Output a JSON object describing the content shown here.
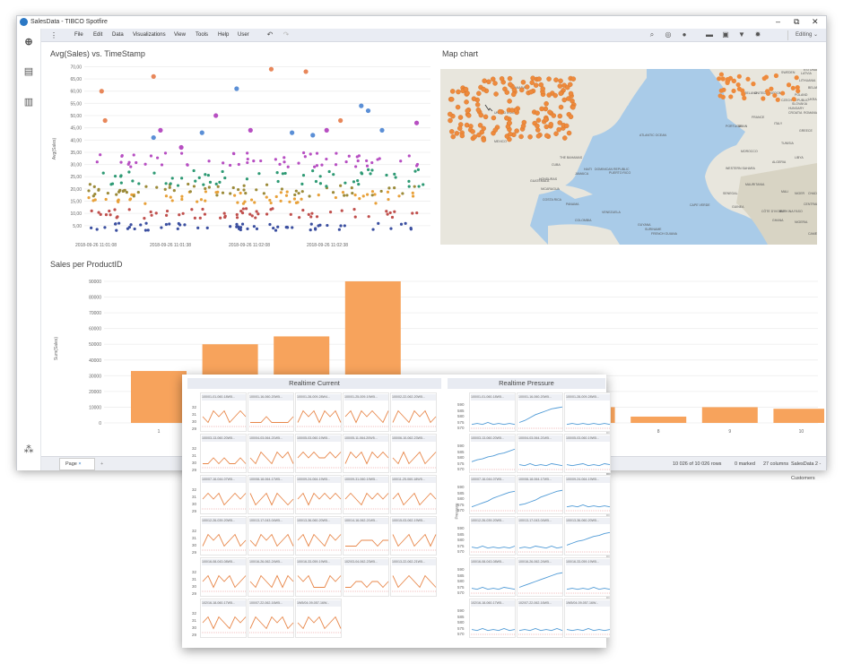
{
  "window": {
    "title": "SalesData - TIBCO Spotfire",
    "controls": {
      "minimize": "–",
      "restore": "⧉",
      "close": "✕"
    }
  },
  "menu": {
    "items": [
      "Menu",
      "File",
      "Edit",
      "Data",
      "Visualizations",
      "View",
      "Tools",
      "Help",
      "User"
    ],
    "mode": "Editing"
  },
  "scatter": {
    "title": "Avg(Sales) vs. TimeStamp",
    "xlabel": "TimeStamp",
    "ylabel": "Avg(Sales)"
  },
  "map": {
    "title": "Map chart",
    "labels": [
      "CANADA",
      "UNITED STATES",
      "MEXICO",
      "ATLANTIC OCEAN",
      "CUBA",
      "THE BAHAMAS",
      "DOMINICAN REPUBLIC",
      "JAMAICA",
      "HAITI",
      "PUERTO RICO",
      "GUATEMALA",
      "HONDURAS",
      "NICARAGUA",
      "COSTA RICA",
      "PANAMA",
      "COLOMBIA",
      "VENEZUELA",
      "GUYANA",
      "SURINAME",
      "FRENCH GUIANA",
      "MOROCCO",
      "ALGERIA",
      "LIBYA",
      "EGYPT",
      "MALI",
      "NIGER",
      "CHAD",
      "SUDAN",
      "MAURITANIA",
      "SENEGAL",
      "GUINEA",
      "CÔTE D'IVOIRE",
      "BURKINA FASO",
      "GHANA",
      "NIGERIA",
      "CENTRAL AFRICAN REPUBLIC",
      "PORTUGAL",
      "SPAIN",
      "FRANCE",
      "ITALY",
      "GREECE",
      "CROATIA",
      "POLAND",
      "CZECH REPUBLIC",
      "SLOVAKIA",
      "UKRAINE",
      "BELARUS",
      "LITHUANIA",
      "LATVIA",
      "ESTONIA",
      "SWEDEN",
      "UNITED KINGDOM",
      "IRELAND",
      "TUNISIA",
      "WESTERN SAHARA",
      "CAPE VERDE",
      "CAMEROON",
      "ROMANIA",
      "HUNGARY"
    ]
  },
  "bar": {
    "title": "Sales per ProductID",
    "ylabel": "Sum(Sales)"
  },
  "chart_data": [
    {
      "type": "scatter",
      "title": "Avg(Sales) vs. TimeStamp",
      "xlabel": "TimeStamp",
      "ylabel": "Avg(Sales)",
      "x_ticks": [
        "2018-09-26 11:01:08",
        "2018-09-26 11:01:38",
        "2018-09-26 11:02:08",
        "2018-09-26 11:02:38"
      ],
      "y_ticks": [
        "5,00",
        "10,00",
        "15,00",
        "20,00",
        "25,00",
        "30,00",
        "35,00",
        "40,00",
        "45,00",
        "50,00",
        "55,00",
        "60,00",
        "65,00",
        "70,00"
      ],
      "ylim": [
        2,
        72
      ],
      "series_bands": [
        {
          "name": "band1",
          "color": "#3b4fa0",
          "y_range": [
            3,
            6
          ]
        },
        {
          "name": "band2",
          "color": "#c0504d",
          "y_range": [
            8,
            12
          ]
        },
        {
          "name": "band3",
          "color": "#e8a13a",
          "y_range": [
            14,
            19
          ]
        },
        {
          "name": "band4",
          "color": "#9c8b3a",
          "y_range": [
            17,
            22
          ]
        },
        {
          "name": "band5",
          "color": "#2e9a74",
          "y_range": [
            21,
            28
          ]
        },
        {
          "name": "band6",
          "color": "#b74fc2",
          "y_range": [
            29,
            35
          ]
        }
      ],
      "outliers": [
        {
          "x": 0.05,
          "y": 60,
          "color": "#e8875a"
        },
        {
          "x": 0.06,
          "y": 48,
          "color": "#e8875a"
        },
        {
          "x": 0.2,
          "y": 66,
          "color": "#e8875a"
        },
        {
          "x": 0.44,
          "y": 61,
          "color": "#5b8fd6"
        },
        {
          "x": 0.54,
          "y": 69,
          "color": "#e8875a"
        },
        {
          "x": 0.64,
          "y": 68,
          "color": "#e8875a"
        },
        {
          "x": 0.8,
          "y": 54,
          "color": "#5b8fd6"
        },
        {
          "x": 0.82,
          "y": 52,
          "color": "#5b8fd6"
        },
        {
          "x": 0.74,
          "y": 48,
          "color": "#e8875a"
        },
        {
          "x": 0.96,
          "y": 47,
          "color": "#b74fc2"
        },
        {
          "x": 0.2,
          "y": 41,
          "color": "#5b8fd6"
        },
        {
          "x": 0.22,
          "y": 44,
          "color": "#b74fc2"
        },
        {
          "x": 0.34,
          "y": 43,
          "color": "#5b8fd6"
        },
        {
          "x": 0.48,
          "y": 44,
          "color": "#b74fc2"
        },
        {
          "x": 0.38,
          "y": 50,
          "color": "#b74fc2"
        },
        {
          "x": 0.6,
          "y": 43,
          "color": "#5b8fd6"
        },
        {
          "x": 0.66,
          "y": 42,
          "color": "#5b8fd6"
        },
        {
          "x": 0.7,
          "y": 44,
          "color": "#b74fc2"
        },
        {
          "x": 0.86,
          "y": 44,
          "color": "#5b8fd6"
        },
        {
          "x": 0.28,
          "y": 37,
          "color": "#b74fc2"
        }
      ]
    },
    {
      "type": "bar",
      "title": "Sales per ProductID",
      "ylabel": "Sum(Sales)",
      "categories": [
        "1",
        "2",
        "3",
        "4",
        "5",
        "6",
        "7",
        "8",
        "9",
        "10"
      ],
      "values": [
        33000,
        50000,
        55000,
        90000,
        12000,
        8000,
        10000,
        4000,
        10000,
        9000
      ],
      "ylim": [
        0,
        90000
      ],
      "y_ticks": [
        "0",
        "10000",
        "20000",
        "30000",
        "40000",
        "50000",
        "60000",
        "70000",
        "80000",
        "90000"
      ],
      "color": "#f7a35c"
    }
  ],
  "overlay": {
    "current": {
      "title": "Realtime Current",
      "y_ticks": [
        "32",
        "31",
        "30",
        "29"
      ],
      "cells": [
        "100/01-01-060-18W5...",
        "100/01-16-060-20W5...",
        "100/01-28-009-28W4...",
        "100/01-25-009-19W5...",
        "100/02-22-062-20W5...",
        "100/03-13-060-20W5...",
        "100/04-03-064-21W5...",
        "100/05-03-060-19W5...",
        "100/05-11-064-20W5...",
        "100/06-10-062-23W5...",
        "100/07-16-044-07W5...",
        "100/08-18-064-17W5...",
        "100/09-24-064-19W5...",
        "100/09-31-060-19W5...",
        "100/11-25-060-18W5...",
        "100/12-26-039-20W5...",
        "100/13-17-043-04W5...",
        "100/13-36-060-20W5...",
        "100/14-16-062-21W5...",
        "100/15-03-062-19W5...",
        "100/16-08-043-08W5...",
        "100/16-26-062-24W5...",
        "100/16-33-059-19W5...",
        "102/03-04-062-23W5...",
        "100/13-22-062-21W5...",
        "102/16-18-060-17W5...",
        "100/07-22-062-16W5...",
        "1W5/04-09-057-16W..."
      ],
      "values": [
        [
          31,
          30,
          32,
          31,
          32,
          30,
          31,
          32,
          31
        ],
        [
          30,
          30,
          30,
          31,
          30,
          30,
          30,
          30,
          31
        ],
        [
          30,
          32,
          31,
          32,
          30,
          32,
          31,
          32,
          30
        ],
        [
          31,
          32,
          30,
          32,
          31,
          32,
          31,
          30,
          32
        ],
        [
          30,
          32,
          31,
          30,
          32,
          31,
          32,
          30,
          31
        ],
        [
          30,
          30,
          31,
          30,
          31,
          30,
          30,
          31,
          30
        ],
        [
          31,
          30,
          32,
          31,
          30,
          32,
          31,
          32,
          30
        ],
        [
          31,
          32,
          31,
          32,
          31,
          31,
          32,
          31,
          32
        ],
        [
          30,
          32,
          31,
          32,
          30,
          32,
          31,
          32,
          31
        ],
        [
          31,
          30,
          32,
          30,
          31,
          32,
          30,
          31,
          32
        ],
        [
          31,
          32,
          31,
          32,
          30,
          31,
          32,
          31,
          32
        ],
        [
          32,
          30,
          31,
          32,
          30,
          32,
          31,
          30,
          31
        ],
        [
          31,
          32,
          30,
          32,
          31,
          32,
          31,
          32,
          31
        ],
        [
          31,
          32,
          31,
          30,
          32,
          31,
          32,
          31,
          32
        ],
        [
          31,
          32,
          30,
          31,
          32,
          30,
          31,
          32,
          31
        ],
        [
          30,
          32,
          31,
          32,
          30,
          31,
          32,
          30,
          31
        ],
        [
          31,
          30,
          32,
          31,
          32,
          30,
          31,
          32,
          30
        ],
        [
          31,
          32,
          30,
          32,
          31,
          30,
          32,
          31,
          32
        ],
        [
          30,
          30,
          30,
          31,
          31,
          31,
          30,
          31,
          31
        ],
        [
          32,
          30,
          31,
          32,
          30,
          31,
          32,
          30,
          32
        ],
        [
          31,
          32,
          30,
          32,
          31,
          32,
          30,
          31,
          32
        ],
        [
          31,
          30,
          32,
          31,
          30,
          32,
          30,
          32,
          31
        ],
        [
          32,
          31,
          32,
          30,
          30,
          30,
          32,
          31,
          32
        ],
        [
          30,
          30,
          31,
          31,
          30,
          31,
          31,
          30,
          31
        ],
        [
          32,
          30,
          31,
          32,
          31,
          30,
          32,
          31,
          30
        ],
        [
          31,
          32,
          30,
          32,
          31,
          30,
          32,
          31,
          32
        ],
        [
          30,
          32,
          31,
          30,
          32,
          31,
          32,
          30,
          31
        ],
        [
          31,
          30,
          32,
          31,
          32,
          30,
          31,
          32,
          30
        ]
      ]
    },
    "pressure": {
      "title": "Realtime Pressure",
      "ylabel": "Pressure",
      "y_ticks": [
        "590",
        "585",
        "580",
        "575",
        "570"
      ],
      "cells": [
        "100/01-01-060-18W5...",
        "100/01-16-060-20W5...",
        "100/01-28-009-28W5...",
        "100/03-13-060-20W5...",
        "100/04-03-064-21W5...",
        "100/05-03-060-19W5...",
        "100/07-16-044-07W5...",
        "100/08-18-064-17W5...",
        "100/09-24-064-19W5...",
        "100/12-26-039-20W5...",
        "100/13-17-043-04W5...",
        "100/13-36-060-20W5...",
        "100/16-08-043-08W5...",
        "100/16-26-062-24W5...",
        "100/16-33-059-19W5...",
        "102/16-18-060-17W5...",
        "102/07-22-062-16W5...",
        "1W5/04-09-057-16W..."
      ],
      "values": [
        [
          572,
          573,
          572,
          574,
          572,
          573,
          572,
          573,
          572
        ],
        [
          574,
          576,
          579,
          582,
          584,
          586,
          588,
          589,
          590
        ],
        [
          572,
          573,
          572,
          573,
          572,
          573,
          572,
          573,
          572
        ],
        [
          576,
          578,
          579,
          581,
          582,
          584,
          585,
          587,
          589
        ],
        [
          573,
          572,
          574,
          572,
          573,
          572,
          574,
          573,
          572
        ],
        [
          573,
          572,
          573,
          574,
          572,
          573,
          572,
          574,
          573
        ],
        [
          572,
          574,
          576,
          578,
          581,
          583,
          585,
          587,
          588
        ],
        [
          574,
          575,
          577,
          579,
          582,
          584,
          586,
          588,
          589
        ],
        [
          572,
          573,
          572,
          574,
          572,
          573,
          572,
          573,
          572
        ],
        [
          573,
          572,
          574,
          572,
          573,
          572,
          573,
          572,
          574
        ],
        [
          572,
          573,
          572,
          574,
          573,
          572,
          574,
          572,
          573
        ],
        [
          575,
          577,
          579,
          580,
          582,
          584,
          585,
          587,
          588
        ],
        [
          573,
          572,
          574,
          572,
          573,
          572,
          574,
          573,
          572
        ],
        [
          574,
          576,
          578,
          580,
          582,
          584,
          586,
          588,
          589
        ],
        [
          572,
          573,
          572,
          573,
          572,
          574,
          572,
          573,
          572
        ],
        [
          573,
          572,
          574,
          572,
          573,
          572,
          574,
          572,
          573
        ],
        [
          572,
          573,
          572,
          574,
          572,
          573,
          572,
          574,
          572
        ],
        [
          573,
          572,
          573,
          572,
          574,
          572,
          573,
          572,
          573
        ]
      ]
    }
  },
  "status": {
    "page_tab": "Page",
    "close": "×",
    "add": "+",
    "rows": "10 026 of 10 026 rows",
    "marked": "0 marked",
    "columns": "27 columns",
    "table": "SalesData 2 - Customers"
  },
  "colors": {
    "bar": "#f7a35c",
    "line_current": "#e8874a",
    "line_pressure": "#4f9ad6",
    "accent": "#2b78c5",
    "map_dot": "#ee8a3c"
  }
}
